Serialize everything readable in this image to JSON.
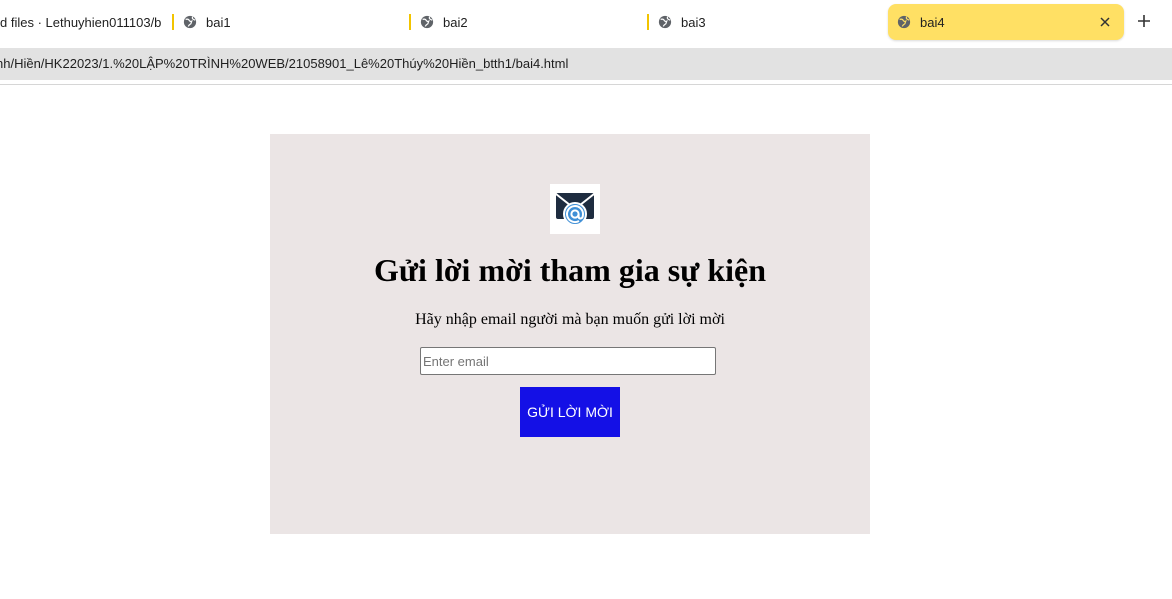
{
  "browser": {
    "tabs": [
      {
        "label": "d files · Lethuyhien011103/b",
        "active": false
      },
      {
        "label": "bai1",
        "active": false
      },
      {
        "label": "bai2",
        "active": false
      },
      {
        "label": "bai3",
        "active": false
      },
      {
        "label": "bai4",
        "active": true
      }
    ],
    "new_tab_icon": "plus-icon",
    "close_icon": "close-icon",
    "tab_icon": "globe-icon",
    "address": "nh/Hiền/HK22023/1.%20LẬP%20TRÌNH%20WEB/21058901_Lê%20Thúy%20Hiền_btth1/bai4.html",
    "active_tab_color": "#ffe064",
    "separator_color": "#f2c400"
  },
  "page": {
    "logo_icon": "mail-at-icon",
    "title": "Gửi lời mời tham gia sự kiện",
    "subtitle": "Hãy nhập email người mà bạn muốn gửi lời mời",
    "email_placeholder": "Enter email",
    "email_value": "",
    "send_button_label": "GỬI LỜI MỜI",
    "card_color": "#ebe5e5",
    "button_color": "#1410e6"
  }
}
